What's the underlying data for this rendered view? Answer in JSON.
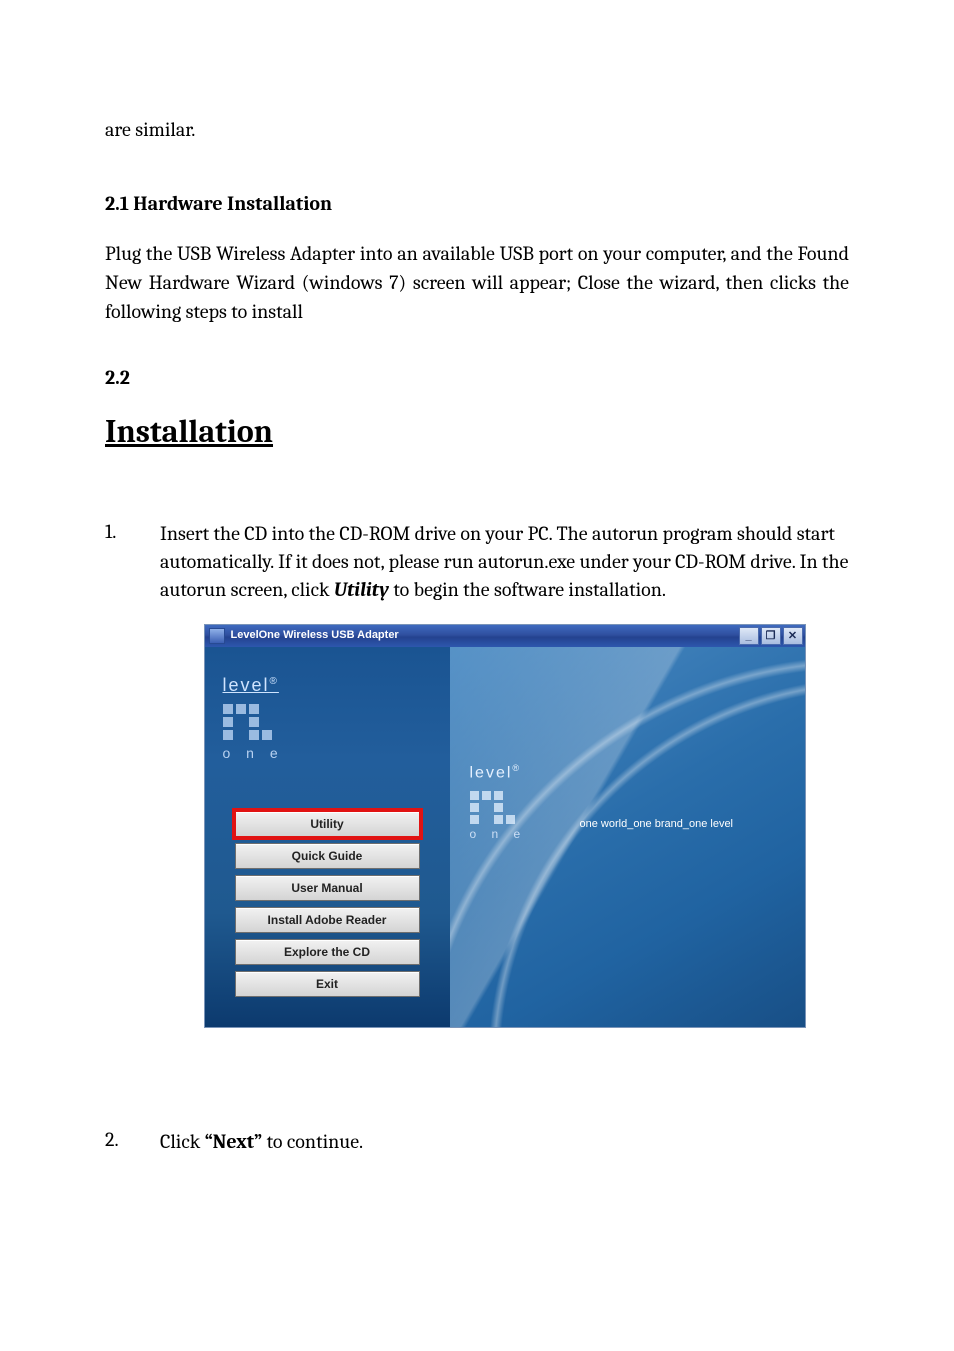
{
  "body": {
    "intro_fragment": "are similar.",
    "section_21_head": "2.1 Hardware Installation",
    "section_21_body": "Plug the USB Wireless Adapter into an available USB port on your computer, and the Found New Hardware Wizard (windows 7) screen will appear; Close the wizard, then clicks the following steps to install",
    "section_22_head": "2.2",
    "h1": "Installation",
    "step1_pre": "Insert the CD into the CD-ROM drive on your PC. The autorun program should start automatically. If it does not, please run autorun.exe under your CD-ROM drive. In the autorun screen, click ",
    "step1_em": "Utility",
    "step1_post": " to begin the software installation.",
    "step2_pre": "Click ",
    "step2_bold": "“Next”",
    "step2_post": " to continue."
  },
  "app": {
    "title": "LevelOne   Wireless USB Adapter",
    "logo_main": "level",
    "logo_sup": "®",
    "logo_sub": "o n e",
    "tagline": "one world_one brand_one level",
    "winctrls": {
      "min": "_",
      "max": "❐",
      "close": "✕"
    },
    "menu": {
      "utility": "Utility",
      "quick_guide": "Quick Guide",
      "user_manual": "User Manual",
      "install_adobe": "Install Adobe Reader",
      "explore_cd": "Explore the CD",
      "exit": "Exit"
    }
  }
}
